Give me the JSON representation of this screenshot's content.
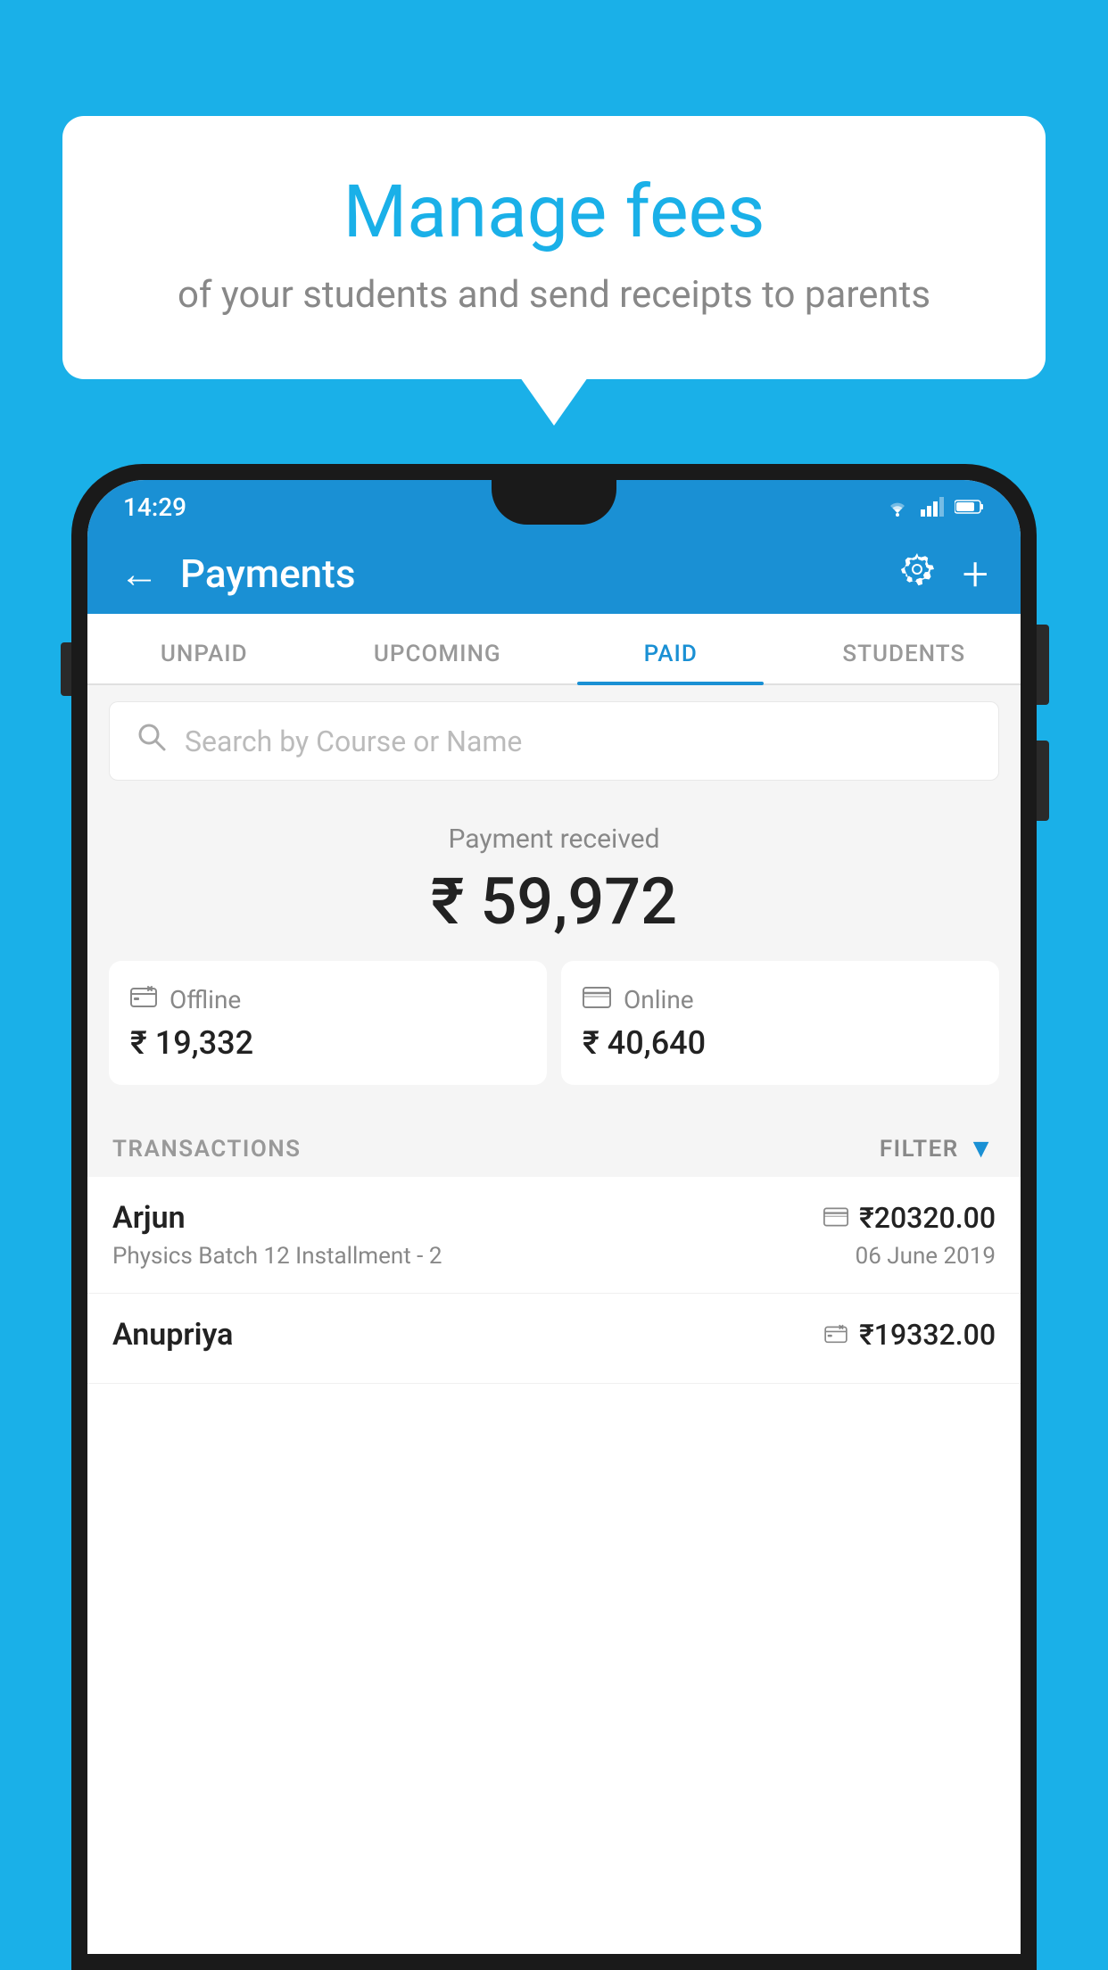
{
  "background": {
    "color": "#1ab0e8"
  },
  "speech_bubble": {
    "title": "Manage fees",
    "subtitle": "of your students and send receipts to parents"
  },
  "phone": {
    "status_bar": {
      "time": "14:29",
      "icons": [
        "wifi",
        "signal",
        "battery"
      ]
    },
    "app_bar": {
      "title": "Payments",
      "back_icon": "←",
      "settings_icon": "⚙",
      "add_icon": "+"
    },
    "tabs": [
      {
        "label": "UNPAID",
        "active": false
      },
      {
        "label": "UPCOMING",
        "active": false
      },
      {
        "label": "PAID",
        "active": true
      },
      {
        "label": "STUDENTS",
        "active": false
      }
    ],
    "search": {
      "placeholder": "Search by Course or Name"
    },
    "payment_summary": {
      "label": "Payment received",
      "amount": "₹ 59,972",
      "offline": {
        "type": "Offline",
        "amount": "₹ 19,332"
      },
      "online": {
        "type": "Online",
        "amount": "₹ 40,640"
      }
    },
    "transactions": {
      "label": "TRANSACTIONS",
      "filter_label": "FILTER",
      "rows": [
        {
          "name": "Arjun",
          "course": "Physics Batch 12 Installment - 2",
          "amount": "₹20320.00",
          "date": "06 June 2019",
          "payment_type": "online"
        },
        {
          "name": "Anupriya",
          "course": "",
          "amount": "₹19332.00",
          "date": "",
          "payment_type": "offline"
        }
      ]
    }
  }
}
